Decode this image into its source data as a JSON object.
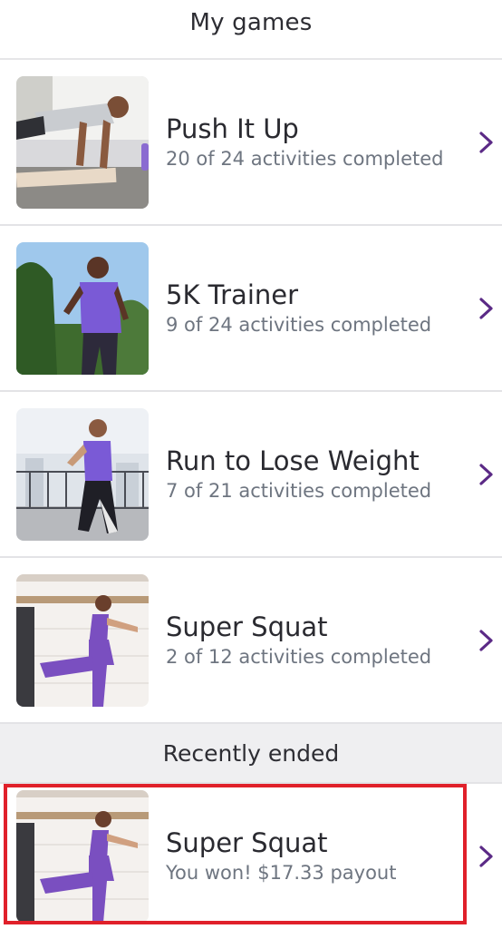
{
  "header": {
    "title": "My games"
  },
  "games": [
    {
      "title": "Push It Up",
      "subtitle": "20 of 24 activities completed",
      "image": "push-up-photo"
    },
    {
      "title": "5K Trainer",
      "subtitle": "9 of 24 activities completed",
      "image": "runner-photo"
    },
    {
      "title": "Run to Lose Weight",
      "subtitle": "7 of 21 activities completed",
      "image": "woman-running-photo"
    },
    {
      "title": "Super Squat",
      "subtitle": "2 of 12 activities completed",
      "image": "squat-photo"
    }
  ],
  "recently_ended": {
    "title": "Recently ended",
    "items": [
      {
        "title": "Super Squat",
        "subtitle": "You won! $17.33 payout",
        "image": "squat-photo"
      }
    ]
  },
  "colors": {
    "chevron": "#5b2a86",
    "highlight": "#e0202a",
    "accent_purple": "#7b4fc0"
  }
}
